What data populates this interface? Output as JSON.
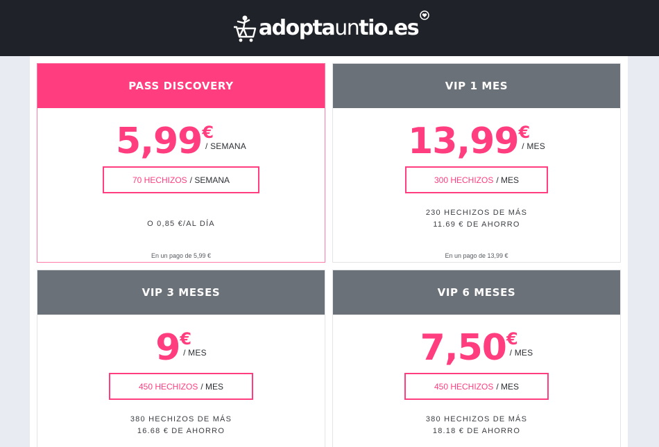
{
  "header": {
    "brand_bold": "adopta",
    "brand_light": "un",
    "brand_end": "tio.es",
    "logo_icon": "shopping-cart-figure-icon",
    "heart_icon": "heart-circle-icon"
  },
  "colors": {
    "accent": "#ff3d7f",
    "header_bg": "#1f2228",
    "card_head_gray": "#6b7178",
    "page_bg": "#e8ebf2"
  },
  "plans": [
    {
      "title": "PASS DISCOVERY",
      "price": "5,99",
      "currency": "€",
      "period": "/ SEMANA",
      "spells_count": "70 HECHIZOS",
      "spells_period": "/ SEMANA",
      "info_line1": "O 0,85 €/AL DÍA",
      "info_line2": "",
      "payment_note": "En un pago de 5,99 €"
    },
    {
      "title": "VIP 1 MES",
      "price": "13,99",
      "currency": "€",
      "period": "/ MES",
      "spells_count": "300 HECHIZOS",
      "spells_period": "/ MES",
      "info_line1": "230 HECHIZOS DE MÁS",
      "info_line2": "11.69 € DE AHORRO",
      "payment_note": "En un pago de 13,99 €"
    },
    {
      "title": "VIP 3 MESES",
      "price": "9",
      "currency": "€",
      "period": "/ MES",
      "spells_count": "450 HECHIZOS",
      "spells_period": "/ MES",
      "info_line1": "380 HECHIZOS DE MÁS",
      "info_line2": "16.68 € DE AHORRO",
      "payment_note": ""
    },
    {
      "title": "VIP 6 MESES",
      "price": "7,50",
      "currency": "€",
      "period": "/ MES",
      "spells_count": "450 HECHIZOS",
      "spells_period": "/ MES",
      "info_line1": "380 HECHIZOS DE MÁS",
      "info_line2": "18.18 € DE AHORRO",
      "payment_note": ""
    }
  ]
}
